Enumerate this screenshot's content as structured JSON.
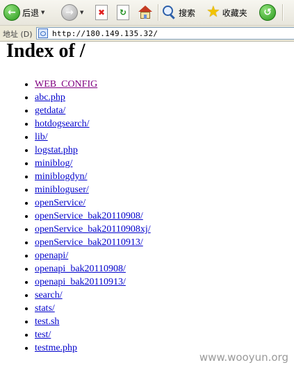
{
  "toolbar": {
    "back_label": "后退",
    "search_label": "搜索",
    "favorites_label": "收藏夹"
  },
  "address_bar": {
    "label": "地址 (D)",
    "url": "http://180.149.135.32/"
  },
  "page": {
    "heading": "Index of /",
    "entries": [
      "WEB_CONFIG",
      "abc.php",
      "getdata/",
      "hotdogsearch/",
      "lib/",
      "logstat.php",
      "miniblog/",
      "miniblogdyn/",
      "minibloguser/",
      "openService/",
      "openService_bak20110908/",
      "openService_bak20110908xj/",
      "openService_bak20110913/",
      "openapi/",
      "openapi_bak20110908/",
      "openapi_bak20110913/",
      "search/",
      "stats/",
      "test.sh",
      "test/",
      "testme.php"
    ]
  },
  "watermark": "www.wooyun.org",
  "icons": {
    "back": "back-arrow-icon",
    "forward": "forward-arrow-icon",
    "stop": "stop-icon",
    "refresh": "refresh-icon",
    "home": "home-icon",
    "search": "search-magnifier-icon",
    "favorites": "favorites-star-icon",
    "history": "history-icon"
  },
  "colors": {
    "link": "#0000cc",
    "visited_link": "#800080"
  }
}
